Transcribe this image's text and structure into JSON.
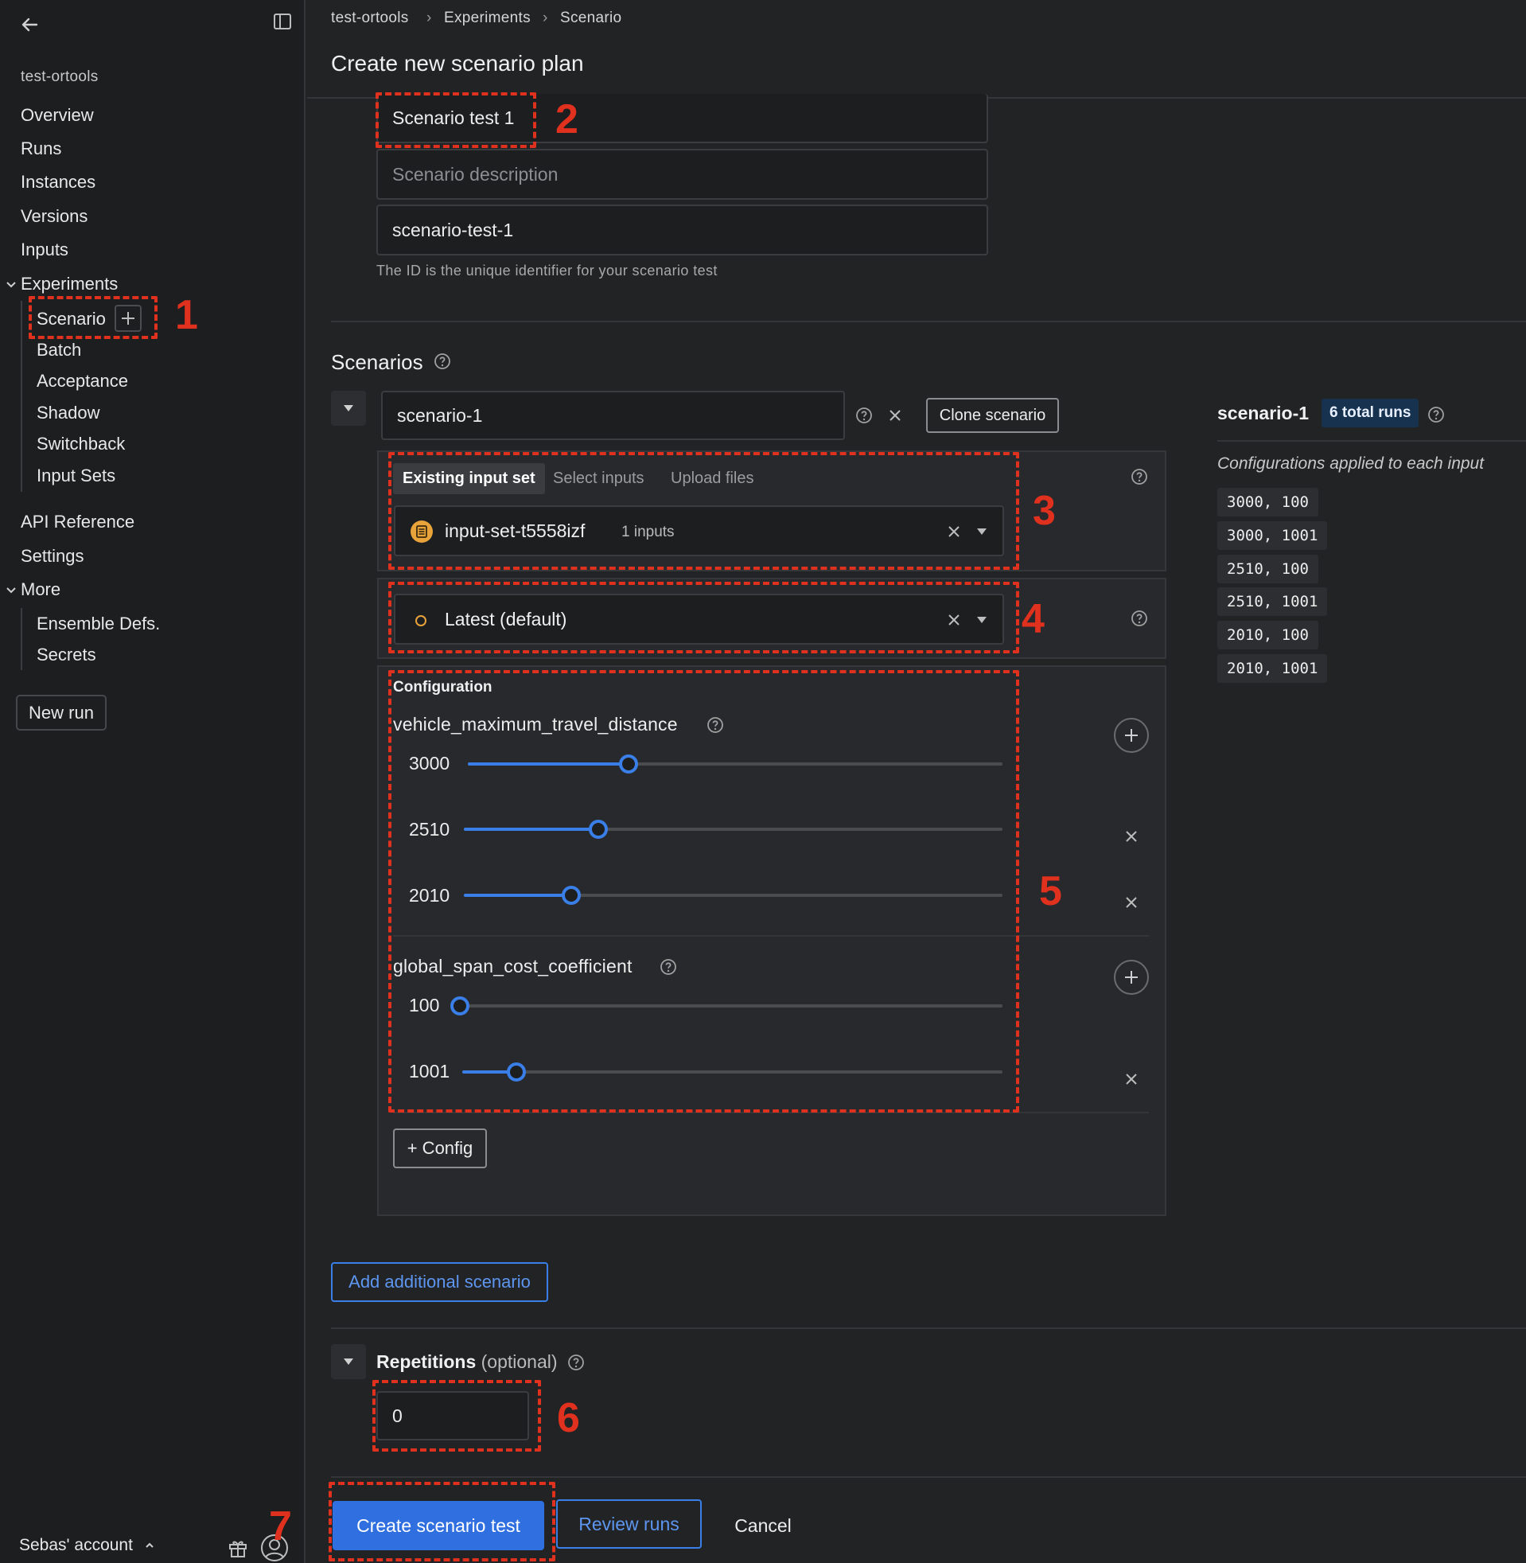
{
  "sidebar": {
    "project": "test-ortools",
    "nav": [
      {
        "label": "Overview"
      },
      {
        "label": "Runs"
      },
      {
        "label": "Instances"
      },
      {
        "label": "Versions"
      },
      {
        "label": "Inputs"
      }
    ],
    "experiments_label": "Experiments",
    "experiments_items": [
      {
        "label": "Scenario"
      },
      {
        "label": "Batch"
      },
      {
        "label": "Acceptance"
      },
      {
        "label": "Shadow"
      },
      {
        "label": "Switchback"
      },
      {
        "label": "Input Sets"
      }
    ],
    "api_reference": "API Reference",
    "settings": "Settings",
    "more_label": "More",
    "more_items": [
      {
        "label": "Ensemble Defs."
      },
      {
        "label": "Secrets"
      }
    ],
    "new_run": "New run",
    "account": "Sebas' account"
  },
  "breadcrumb": [
    "test-ortools",
    "Experiments",
    "Scenario"
  ],
  "page_title": "Create new scenario plan",
  "form": {
    "name_value": "Scenario test 1",
    "description_placeholder": "Scenario description",
    "id_value": "scenario-test-1",
    "id_hint": "The ID is the unique identifier for your scenario test"
  },
  "scenarios": {
    "title": "Scenarios",
    "scenario_name": "scenario-1",
    "clone_label": "Clone scenario",
    "tabs": [
      "Existing input set",
      "Select inputs",
      "Upload files"
    ],
    "input_set": "input-set-t5558izf",
    "input_count": "1 inputs",
    "version": "Latest (default)",
    "configuration_label": "Configuration",
    "configs": [
      {
        "name": "vehicle_maximum_travel_distance",
        "values": [
          {
            "label": "3000",
            "fraction": 0.3
          },
          {
            "label": "2510",
            "fraction": 0.25
          },
          {
            "label": "2010",
            "fraction": 0.2
          }
        ]
      },
      {
        "name": "global_span_cost_coefficient",
        "values": [
          {
            "label": "100",
            "fraction": 0.0
          },
          {
            "label": "1001",
            "fraction": 0.1
          }
        ]
      }
    ],
    "add_config": "+ Config",
    "add_scenario": "Add additional scenario"
  },
  "summary": {
    "title": "scenario-1",
    "badge": "6 total runs",
    "subtitle": "Configurations applied to each input",
    "configs": [
      "3000, 100",
      "3000, 1001",
      "2510, 100",
      "2510, 1001",
      "2010, 100",
      "2010, 1001"
    ]
  },
  "repetitions": {
    "label": "Repetitions",
    "optional": "(optional)",
    "value": "0"
  },
  "actions": {
    "create": "Create scenario test",
    "review": "Review runs",
    "cancel": "Cancel"
  },
  "annotations": [
    "1",
    "2",
    "3",
    "4",
    "5",
    "6",
    "7"
  ],
  "colors": {
    "annotation": "#e0301e",
    "accent": "#3a7ee8",
    "primary_button": "#2f6fe0"
  }
}
